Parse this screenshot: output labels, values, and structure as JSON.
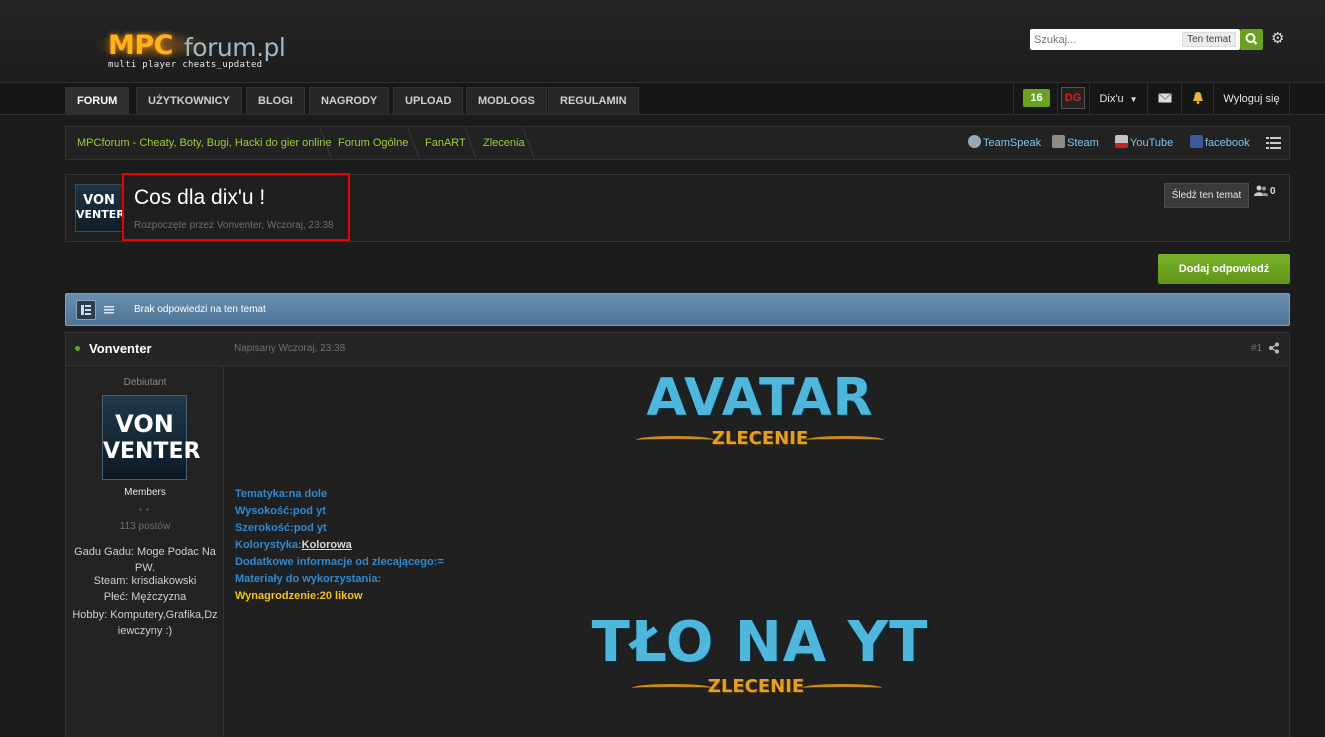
{
  "header": {
    "logo_main": "MPC",
    "logo_sub": "forum.pl",
    "logo_tagline": "multi player cheats_updated",
    "search_placeholder": "Szukaj...",
    "search_scope": "Ten temat"
  },
  "nav": {
    "tabs": [
      "FORUM",
      "UŻYTKOWNICY",
      "BLOGI",
      "NAGRODY",
      "UPLOAD",
      "MODLOGS",
      "REGULAMIN"
    ],
    "notifications_count": "16",
    "user_badge": "DG",
    "username": "Dix'u",
    "logout": "Wyloguj się"
  },
  "breadcrumb": {
    "items": [
      "MPCforum - Cheaty, Boty, Bugi, Hacki do gier online",
      "Forum Ogólne",
      "FanART",
      "Zlecenia"
    ]
  },
  "social": {
    "items": [
      "TeamSpeak",
      "Steam",
      "YouTube",
      "facebook"
    ]
  },
  "topic": {
    "title": "Cos dla dix'u !",
    "meta": "Rozpoczęte przez Vonventer, Wczoraj, 23:38",
    "follow_label": "Śledź ten temat",
    "followers": "0",
    "avatar_text": "VON\nVENTER"
  },
  "actions": {
    "reply_label": "Dodaj odpowiedź"
  },
  "infobar": {
    "text": "Brak odpowiedzi na ten temat"
  },
  "post": {
    "author": "Vonventer",
    "posted": "Napisany Wczoraj, 23:38",
    "number": "#1",
    "rank": "Debiutant",
    "avatar_line1": "VON",
    "avatar_line2": "VENTER",
    "group": "Members",
    "posts": "113 postów",
    "profile": {
      "gadu": "Gadu Gadu: Moge Podac Na PW.",
      "steam": "Steam: krisdiakowski",
      "gender": "Płeć: Mężczyzna",
      "hobby": "Hobby: Komputery,Grafika,Dziewczyny :)"
    },
    "banner1_title": "AVATAR",
    "banner1_sub": "ZLECENIE",
    "fields": {
      "tematyka": "Tematyka:na dole",
      "wysokosc": "Wysokość:pod yt",
      "szerokosc": "Szerokość:pod yt",
      "kolorystyka_label": "Kolorystyka:",
      "kolorystyka_value": "Kolorowa",
      "dodatkowe": "Dodatkowe informacje od zlecającego:=",
      "materialy": "Materiały do wykorzystania:",
      "wynagrodzenie": "Wynagrodzenie:20 likow"
    },
    "banner2_title": "TŁO NA YT",
    "banner2_sub": "ZLECENIE"
  },
  "colors": {
    "accent_green": "#6aa11f",
    "link_green": "#9bcf3a",
    "field_blue": "#2f8ad1",
    "reward_gold": "#f0c419",
    "infobar_blue": "#5a7fa3"
  }
}
